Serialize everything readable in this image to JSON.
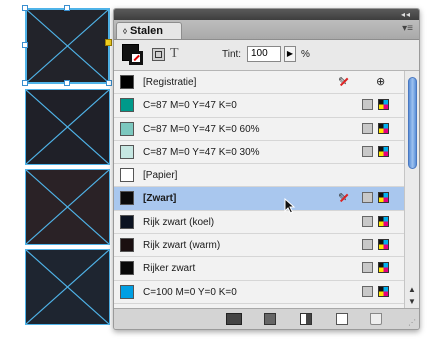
{
  "panel": {
    "tab_label": "Stalen",
    "tint_label": "Tint:",
    "tint_value": "100",
    "percent_sign": "%",
    "t_label": "T"
  },
  "swatches": [
    {
      "name": "[Registratie]",
      "color": "#000000",
      "icons": [
        "non-editable",
        "registration"
      ]
    },
    {
      "name": "C=87 M=0 Y=47 K=0",
      "color": "#00998a",
      "icons": [
        "spot",
        "cmyk"
      ]
    },
    {
      "name": "C=87 M=0 Y=47 K=0 60%",
      "color": "#7cc8bf",
      "icons": [
        "spot",
        "cmyk"
      ]
    },
    {
      "name": "C=87 M=0 Y=47 K=0 30%",
      "color": "#c6e7e2",
      "icons": [
        "spot",
        "cmyk"
      ]
    },
    {
      "name": "[Papier]",
      "color": "#ffffff",
      "icons": []
    },
    {
      "name": "[Zwart]",
      "color": "#0a0a0a",
      "icons": [
        "non-editable",
        "spot",
        "cmyk"
      ],
      "selected": true
    },
    {
      "name": "Rijk zwart (koel)",
      "color": "#0b1220",
      "icons": [
        "spot",
        "cmyk"
      ]
    },
    {
      "name": "Rijk zwart (warm)",
      "color": "#1a0f10",
      "icons": [
        "spot",
        "cmyk"
      ]
    },
    {
      "name": "Rijker zwart",
      "color": "#080808",
      "icons": [
        "spot",
        "cmyk"
      ]
    },
    {
      "name": "C=100 M=0 Y=0 K=0",
      "color": "#009fe3",
      "icons": [
        "spot",
        "cmyk"
      ]
    }
  ],
  "colors": {
    "selection": "#a9c7ee",
    "frame_border": "#4fb3e8"
  }
}
